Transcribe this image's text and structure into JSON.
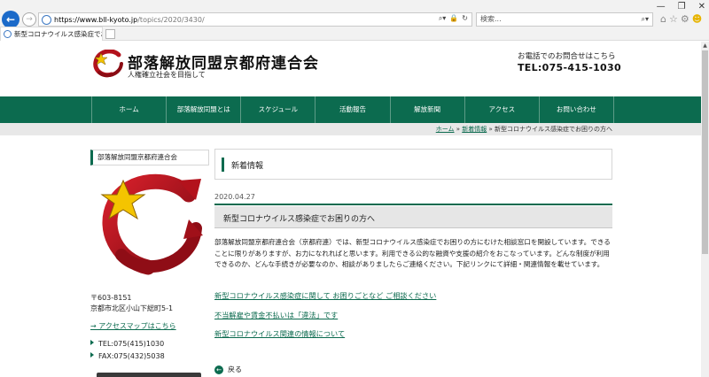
{
  "browser": {
    "url_host": "https://www.bll-kyoto.jp",
    "url_path": "/topics/2020/3430/",
    "search_placeholder": "検索...",
    "tab_title": "新型コロナウイルス感染症でお…",
    "window_buttons": [
      "—",
      "❐",
      "✕"
    ]
  },
  "header": {
    "title": "部落解放同盟京都府連合会",
    "tagline": "人権確立社会を目指して",
    "contact_label": "お電話でのお問合せはこちら",
    "contact_tel": "TEL:075-415-1030"
  },
  "nav": {
    "items": [
      "ホーム",
      "部落解放同盟とは",
      "スケジュール",
      "活動報告",
      "解放新聞",
      "アクセス",
      "お問い合わせ"
    ]
  },
  "breadcrumb": {
    "home": "ホーム",
    "sep": " » ",
    "category": "新着情報",
    "current": "新型コロナウイルス感染症でお困りの方へ"
  },
  "sidebar": {
    "heading": "部落解放同盟京都府連合会",
    "postal": "〒603-8151",
    "address": "京都市北区小山下総町5-1",
    "map_link": "→ アクセスマップはこちら",
    "tel": "TEL:075(415)1030",
    "fax": "FAX:075(432)5038"
  },
  "main": {
    "section_heading": "新着情報",
    "date": "2020.04.27",
    "post_title": "新型コロナウイルス感染症でお困りの方へ",
    "body": "部落解放同盟京都府連合会（京都府連）では、新型コロナウイルス感染症でお困りの方にむけた相談窓口を開設しています。できることに限りがありますが、お力になれればと思います。利用できる公的な融資や支援の紹介をおこなっています。どんな制度が利用できるのか、どんな手続きが必要なのか、相談がありましたらご連絡ください。下記リンクにて詳細・関連情報を載せています。",
    "links": [
      "新型コロナウイルス感染症に関して お困りごとなど ご相談ください",
      "不当解雇や賃金不払いは「違法」です",
      "新型コロナウイルス関連の情報について"
    ],
    "back": "戻る"
  },
  "colors": {
    "brand_green": "#0c6b4f",
    "browser_blue": "#1b6ac9",
    "logo_red": "#b3121c"
  }
}
